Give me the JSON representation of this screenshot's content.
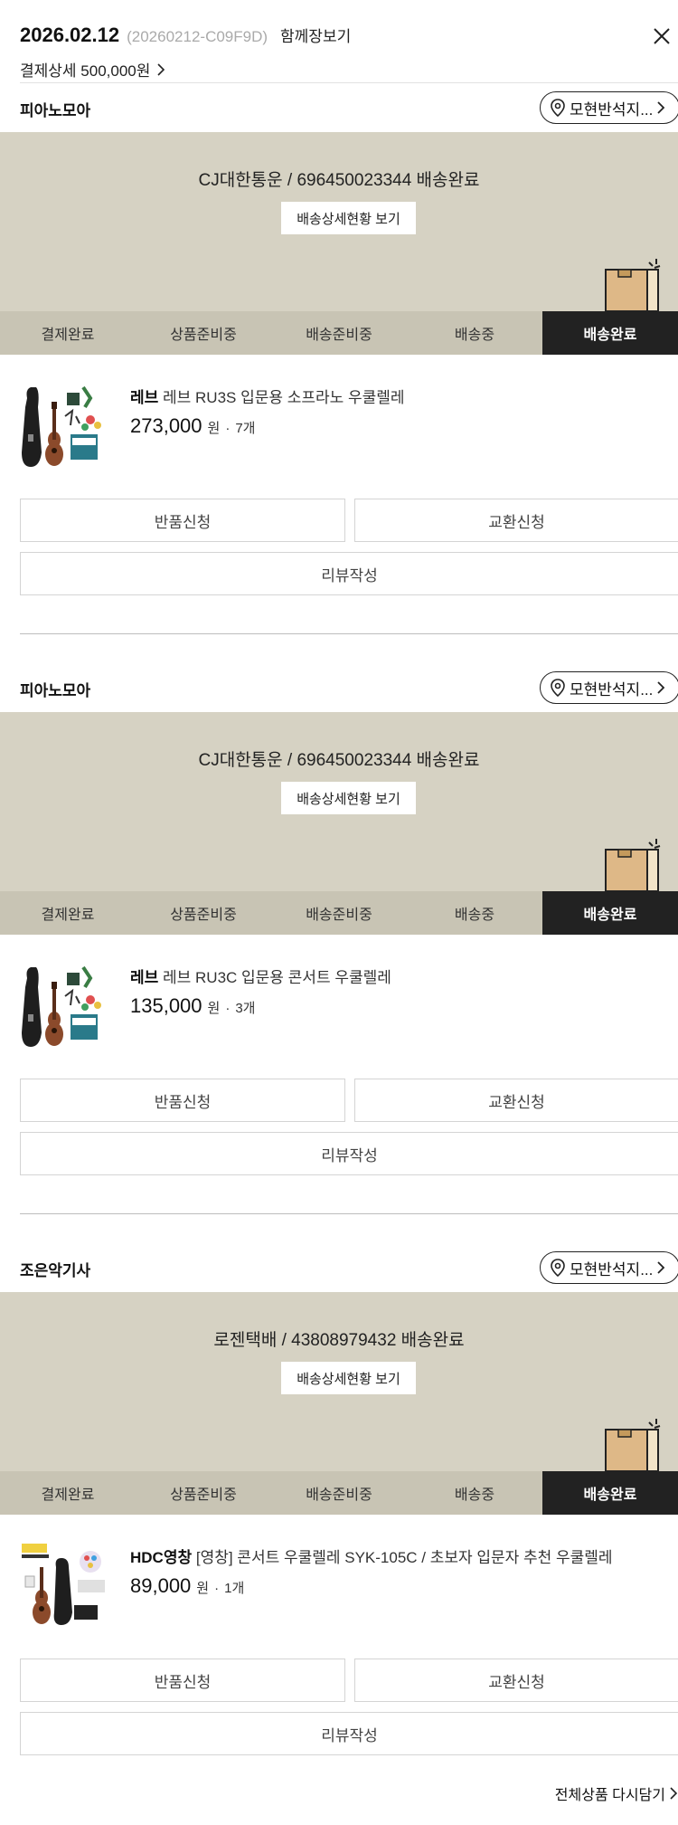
{
  "order": {
    "date": "2026.02.12",
    "id": "(20260212-C09F9D)",
    "together_cart": "함께장보기",
    "pay_detail": "결제상세 500,000원"
  },
  "location_button_label": "모현반석지...",
  "ship_detail_button": "배송상세현황 보기",
  "steps": [
    "결제완료",
    "상품준비중",
    "배송준비중",
    "배송중",
    "배송완료"
  ],
  "active_step": "배송완료",
  "actions": {
    "return": "반품신청",
    "exchange": "교환신청",
    "review": "리뷰작성"
  },
  "sellers": [
    {
      "name": "피아노모아",
      "shipping": "CJ대한통운 / 696450023344 배송완료",
      "product": {
        "brand": "레브",
        "title": "레브 RU3S 입문용 소프라노 우쿨렐레",
        "price": "273,000",
        "unit": "원",
        "qty": "7개"
      }
    },
    {
      "name": "피아노모아",
      "shipping": "CJ대한통운 / 696450023344 배송완료",
      "product": {
        "brand": "레브",
        "title": "레브 RU3C 입문용 콘서트 우쿨렐레",
        "price": "135,000",
        "unit": "원",
        "qty": "3개"
      }
    },
    {
      "name": "조은악기사",
      "shipping": "로젠택배 / 43808979432 배송완료",
      "product": {
        "brand": "HDC영창",
        "title": "[영창] 콘서트 우쿨렐레 SYK-105C / 초보자 입문자 추천 우쿨렐레",
        "price": "89,000",
        "unit": "원",
        "qty": "1개"
      }
    }
  ],
  "reorder_all": "전체상품 다시담기",
  "colors": {
    "banner": "#d6d2c3",
    "steps_bar": "#c8c4b4",
    "active_step": "#222222"
  }
}
